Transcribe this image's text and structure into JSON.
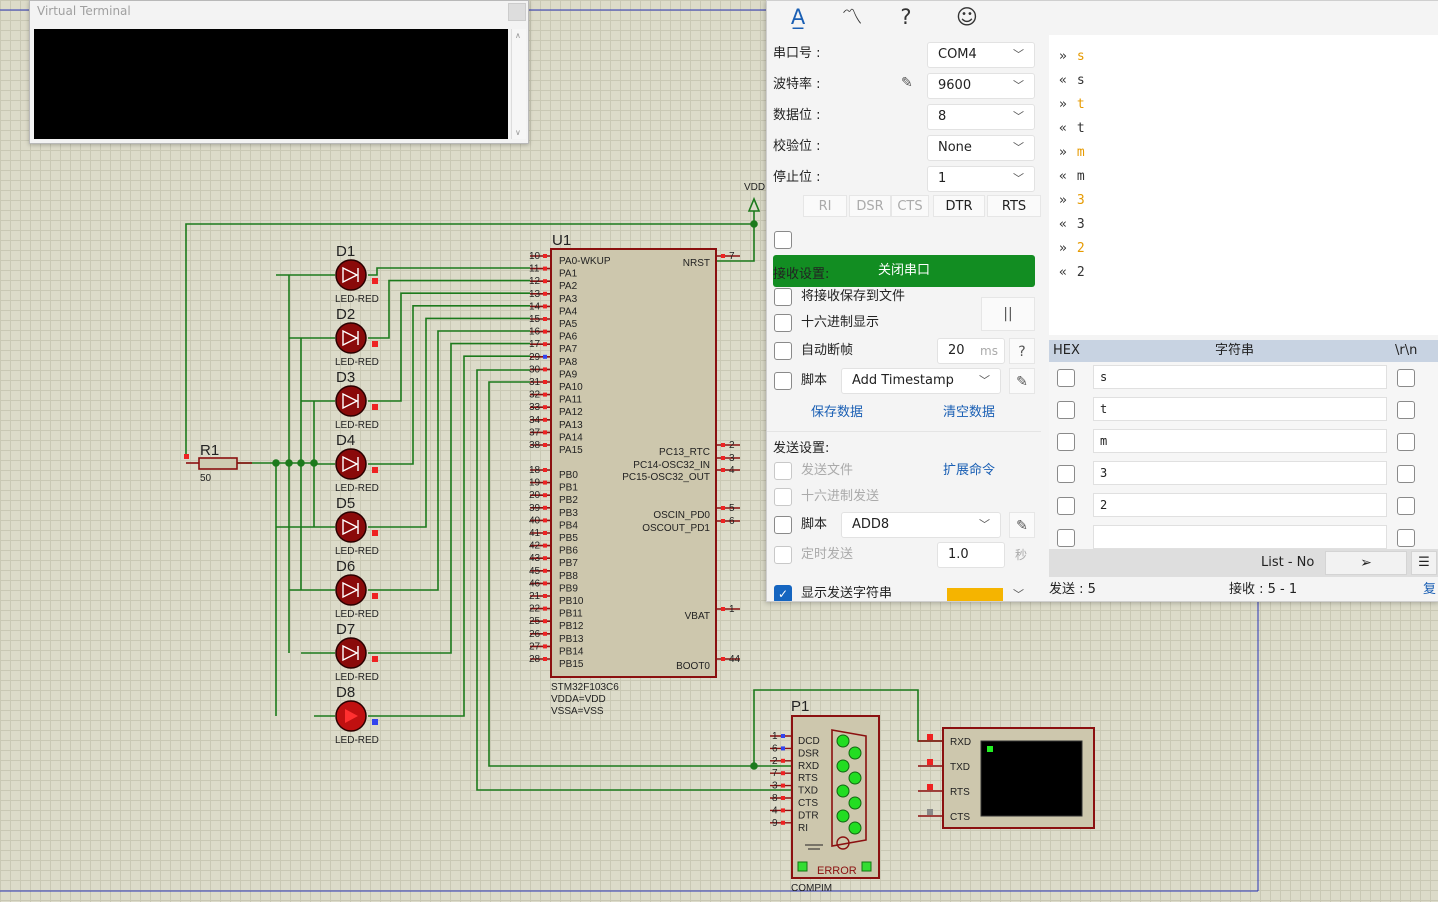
{
  "virtual_terminal": {
    "title": "Virtual Terminal"
  },
  "schematic": {
    "vdd": "VDD",
    "mcu": {
      "ref": "U1",
      "part": "STM32F103C6",
      "prop1": "VDDA=VDD",
      "prop2": "VSSA=VSS",
      "left_pins": [
        {
          "num": "10",
          "name": "PA0-WKUP"
        },
        {
          "num": "11",
          "name": "PA1"
        },
        {
          "num": "12",
          "name": "PA2"
        },
        {
          "num": "13",
          "name": "PA3"
        },
        {
          "num": "14",
          "name": "PA4"
        },
        {
          "num": "15",
          "name": "PA5"
        },
        {
          "num": "16",
          "name": "PA6"
        },
        {
          "num": "17",
          "name": "PA7"
        },
        {
          "num": "29",
          "name": "PA8"
        },
        {
          "num": "30",
          "name": "PA9"
        },
        {
          "num": "31",
          "name": "PA10"
        },
        {
          "num": "32",
          "name": "PA11"
        },
        {
          "num": "33",
          "name": "PA12"
        },
        {
          "num": "34",
          "name": "PA13"
        },
        {
          "num": "37",
          "name": "PA14"
        },
        {
          "num": "38",
          "name": "PA15"
        },
        {
          "num": "18",
          "name": "PB0"
        },
        {
          "num": "19",
          "name": "PB1"
        },
        {
          "num": "20",
          "name": "PB2"
        },
        {
          "num": "39",
          "name": "PB3"
        },
        {
          "num": "40",
          "name": "PB4"
        },
        {
          "num": "41",
          "name": "PB5"
        },
        {
          "num": "42",
          "name": "PB6"
        },
        {
          "num": "43",
          "name": "PB7"
        },
        {
          "num": "45",
          "name": "PB8"
        },
        {
          "num": "46",
          "name": "PB9"
        },
        {
          "num": "21",
          "name": "PB10"
        },
        {
          "num": "22",
          "name": "PB11"
        },
        {
          "num": "25",
          "name": "PB12"
        },
        {
          "num": "26",
          "name": "PB13"
        },
        {
          "num": "27",
          "name": "PB14"
        },
        {
          "num": "28",
          "name": "PB15"
        }
      ],
      "right_pins": [
        {
          "num": "7",
          "name": "NRST"
        },
        {
          "num": "2",
          "name": "PC13_RTC"
        },
        {
          "num": "3",
          "name": "PC14-OSC32_IN"
        },
        {
          "num": "4",
          "name": "PC15-OSC32_OUT"
        },
        {
          "num": "5",
          "name": "OSCIN_PD0"
        },
        {
          "num": "6",
          "name": "OSCOUT_PD1"
        },
        {
          "num": "1",
          "name": "VBAT"
        },
        {
          "num": "44",
          "name": "BOOT0"
        }
      ]
    },
    "resistor": {
      "ref": "R1",
      "value": "50"
    },
    "leds": [
      {
        "ref": "D1",
        "type": "LED-RED"
      },
      {
        "ref": "D2",
        "type": "LED-RED"
      },
      {
        "ref": "D3",
        "type": "LED-RED"
      },
      {
        "ref": "D4",
        "type": "LED-RED"
      },
      {
        "ref": "D5",
        "type": "LED-RED"
      },
      {
        "ref": "D6",
        "type": "LED-RED"
      },
      {
        "ref": "D7",
        "type": "LED-RED"
      },
      {
        "ref": "D8",
        "type": "LED-RED"
      }
    ],
    "connector": {
      "ref": "P1",
      "part": "COMPIM",
      "error": "ERROR",
      "pins": [
        {
          "num": "1",
          "name": "DCD"
        },
        {
          "num": "6",
          "name": "DSR"
        },
        {
          "num": "2",
          "name": "RXD"
        },
        {
          "num": "7",
          "name": "RTS"
        },
        {
          "num": "3",
          "name": "TXD"
        },
        {
          "num": "8",
          "name": "CTS"
        },
        {
          "num": "4",
          "name": "DTR"
        },
        {
          "num": "9",
          "name": "RI"
        }
      ]
    },
    "terminal_pins": [
      "RXD",
      "TXD",
      "RTS",
      "CTS"
    ]
  },
  "serial_tool": {
    "toolbar_icons": [
      "font-style-icon",
      "waveform-icon",
      "help-icon",
      "smiley-icon"
    ],
    "toolbar_glyphs": [
      "A̲",
      "〽",
      "?",
      "☺"
    ],
    "settings": [
      {
        "label": "串口号 :",
        "value": "COM4"
      },
      {
        "label": "波特率 :",
        "value": "9600"
      },
      {
        "label": "数据位 :",
        "value": "8"
      },
      {
        "label": "校验位 :",
        "value": "None"
      },
      {
        "label": "停止位 :",
        "value": "1"
      }
    ],
    "signals": [
      {
        "label": "RI",
        "enabled": false
      },
      {
        "label": "DSR",
        "enabled": false
      },
      {
        "label": "CTS",
        "enabled": false
      },
      {
        "label": "DTR",
        "enabled": true
      },
      {
        "label": "RTS",
        "enabled": true
      }
    ],
    "close_port": "关闭串口",
    "receive_section": "接收设置:",
    "save_to_file": "将接收保存到文件",
    "hex_display": "十六进制显示",
    "pause_glyph": "||",
    "auto_frame": "自动断帧",
    "auto_frame_value": "20",
    "auto_frame_unit": "ms",
    "help_q": "?",
    "script_label": "脚本",
    "recv_script": "Add Timestamp",
    "save_data": "保存数据",
    "clear_data": "清空数据",
    "send_section": "发送设置:",
    "send_file": "发送文件",
    "ext_cmd": "扩展命令",
    "hex_send": "十六进制发送",
    "send_script": "ADD8",
    "timed_send": "定时发送",
    "timed_value": "1.0",
    "timed_unit": "秒",
    "show_send": "显示发送字符串",
    "terminal_lines": [
      {
        "dir": "»",
        "text": "s",
        "tx": true
      },
      {
        "dir": "«",
        "text": "s",
        "tx": false
      },
      {
        "dir": "»",
        "text": "t",
        "tx": true
      },
      {
        "dir": "«",
        "text": "t",
        "tx": false
      },
      {
        "dir": "»",
        "text": "m",
        "tx": true
      },
      {
        "dir": "«",
        "text": "m",
        "tx": false
      },
      {
        "dir": "»",
        "text": "3",
        "tx": true
      },
      {
        "dir": "«",
        "text": "3",
        "tx": false
      },
      {
        "dir": "»",
        "text": "2",
        "tx": true
      },
      {
        "dir": "«",
        "text": "2",
        "tx": false
      }
    ],
    "grid_headers": {
      "hex": "HEX",
      "string": "字符串",
      "crlf": "\\r\\n"
    },
    "grid_rows": [
      "s",
      "t",
      "m",
      "3",
      "2",
      ""
    ],
    "list_mode": "List - No",
    "send_glyph": "➢",
    "status": {
      "sent": "发送 : 5",
      "received": "接收 : 5 - 1",
      "copy": "复"
    },
    "colors": {
      "accent": "#128d22",
      "tx_text": "#e69a00",
      "link": "#1a5fb4"
    }
  }
}
